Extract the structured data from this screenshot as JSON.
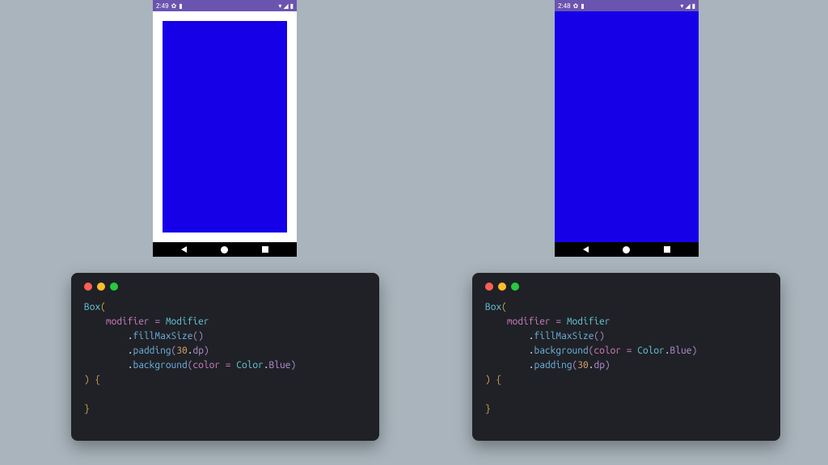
{
  "left_phone": {
    "time": "2:49",
    "has_padding_first": true
  },
  "right_phone": {
    "time": "2:48",
    "has_padding_first": false
  },
  "colors": {
    "blue": "#1600e8",
    "status_bar": "#6a54b0",
    "code_bg": "#1f2126"
  },
  "code_left": {
    "l1_a": "Box",
    "l1_b": "(",
    "l2_a": "modifier",
    "l2_b": " = ",
    "l2_c": "Modifier",
    "l3_a": ".",
    "l3_b": "fillMaxSize",
    "l3_c": "()",
    "l4_a": ".",
    "l4_b": "padding",
    "l4_c": "(",
    "l4_d": "30",
    "l4_e": ".",
    "l4_f": "dp",
    "l4_g": ")",
    "l5_a": ".",
    "l5_b": "background",
    "l5_c": "(",
    "l5_d": "color",
    "l5_e": " = ",
    "l5_f": "Color",
    "l5_g": ".",
    "l5_h": "Blue",
    "l5_i": ")",
    "l6_a": ")",
    "l6_b": " {",
    "l7": "",
    "l8": "}"
  },
  "code_right": {
    "l1_a": "Box",
    "l1_b": "(",
    "l2_a": "modifier",
    "l2_b": " = ",
    "l2_c": "Modifier",
    "l3_a": ".",
    "l3_b": "fillMaxSize",
    "l3_c": "()",
    "l4_a": ".",
    "l4_b": "background",
    "l4_c": "(",
    "l4_d": "color",
    "l4_e": " = ",
    "l4_f": "Color",
    "l4_g": ".",
    "l4_h": "Blue",
    "l4_i": ")",
    "l5_a": ".",
    "l5_b": "padding",
    "l5_c": "(",
    "l5_d": "30",
    "l5_e": ".",
    "l5_f": "dp",
    "l5_g": ")",
    "l6_a": ")",
    "l6_b": " {",
    "l7": "",
    "l8": "}"
  }
}
